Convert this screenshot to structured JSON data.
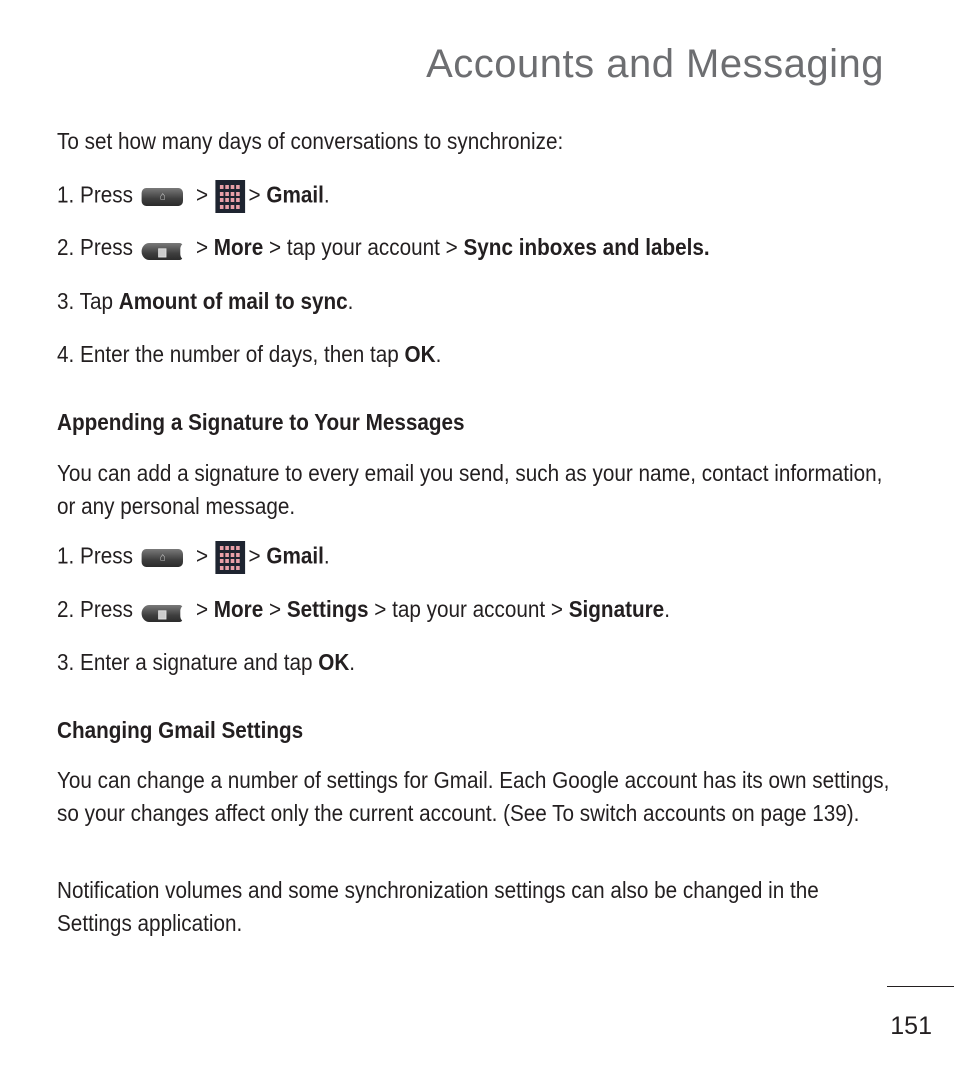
{
  "page": {
    "title": "Accounts and Messaging",
    "page_number": "151"
  },
  "sync_section": {
    "intro": "To set how many days of conversations to synchronize:",
    "step1": {
      "num": "1. Press",
      "sep1": ">",
      "sep2": "> ",
      "target": "Gmail",
      "end": "."
    },
    "step2": {
      "num": "2. Press",
      "sep1": "> ",
      "more": "More",
      "mid": " > tap your account > ",
      "target": "Sync inboxes and labels."
    },
    "step3": {
      "prefix": "3. Tap ",
      "target": "Amount of mail to sync",
      "end": "."
    },
    "step4": {
      "prefix": "4. Enter the number of days, then tap ",
      "target": "OK",
      "end": "."
    }
  },
  "signature_section": {
    "heading": "Appending a Signature to Your Messages",
    "body": "You can add a signature to every email you send, such as your name, contact information, or any personal message.",
    "step1": {
      "num": "1. Press",
      "sep1": ">",
      "sep2": "> ",
      "target": "Gmail",
      "end": "."
    },
    "step2": {
      "num": "2. Press",
      "sep1": "> ",
      "more": "More",
      "sep3": " > ",
      "settings": "Settings",
      "mid": " > tap your account > ",
      "target": "Signature",
      "end": "."
    },
    "step3": {
      "prefix": "3. Enter a signature and tap ",
      "target": "OK",
      "end": "."
    }
  },
  "gmail_settings_section": {
    "heading": "Changing Gmail Settings",
    "body1": "You can change a number of settings for Gmail. Each Google account has its own settings, so your changes affect only the current account. (See To switch accounts on page 139).",
    "body2": "Notification volumes and some synchronization settings can also be changed in the Settings application."
  },
  "icons": {
    "home_key": "home-key-icon",
    "apps_grid": "applications-grid-icon",
    "menu_key": "menu-key-icon"
  },
  "colors": {
    "title": "#6d6e71",
    "text": "#231f20",
    "apps_bg": "#1e2430",
    "apps_dots": "#e9a0a8"
  }
}
